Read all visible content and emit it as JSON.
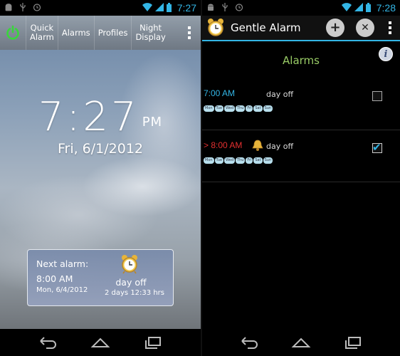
{
  "left": {
    "status_time": "7:27",
    "action_bar": {
      "items": [
        {
          "label_line1": "Quick",
          "label_line2": "Alarm"
        },
        {
          "label_line1": "Alarms",
          "label_line2": ""
        },
        {
          "label_line1": "Profiles",
          "label_line2": ""
        },
        {
          "label_line1": "Night",
          "label_line2": "Display"
        }
      ]
    },
    "clock": {
      "time": "7:27",
      "ampm": "PM",
      "date": "Fri, 6/1/2012"
    },
    "next_alarm": {
      "title": "Next alarm:",
      "time": "8:00 AM",
      "date": "Mon, 6/4/2012",
      "label": "day off",
      "remaining": "2 days 12:33 hrs"
    }
  },
  "right": {
    "status_time": "7:28",
    "app_title": "Gentle Alarm",
    "section_title": "Alarms",
    "info_label": "i",
    "alarms": [
      {
        "time": "7:00 AM",
        "label": "day off",
        "enabled": false,
        "color": "#33b5e5",
        "days": [
          "Mon",
          "Tue",
          "Wed",
          "Thu",
          "Fri",
          "Sat",
          "Sun"
        ]
      },
      {
        "time": "> 8:00 AM",
        "label": "day off",
        "enabled": true,
        "color": "#e53030",
        "days": [
          "Mon",
          "Tue",
          "Wed",
          "Thu",
          "Fri",
          "Sat",
          "Sun"
        ]
      }
    ]
  },
  "colors": {
    "accent": "#33b5e5",
    "section_title": "#99cc66",
    "next_alarm_red": "#e53030"
  }
}
